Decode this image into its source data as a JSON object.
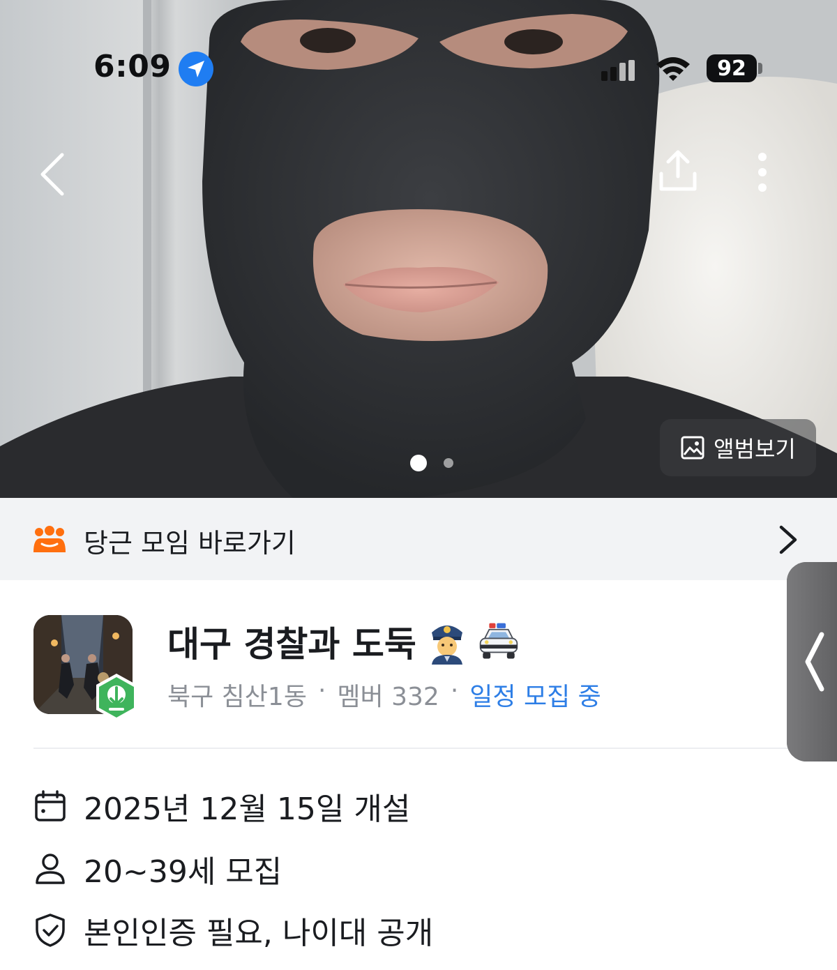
{
  "status_bar": {
    "time": "6:09",
    "battery": "92",
    "icons": [
      "location-arrow-icon",
      "cellular-signal-icon",
      "wifi-icon",
      "battery-icon"
    ]
  },
  "header": {
    "back_icon": "chevron-left-icon",
    "share_icon": "share-icon",
    "more_icon": "more-vertical-icon"
  },
  "gallery": {
    "album_label": "앨범보기",
    "album_icon": "image-icon",
    "pages": 2,
    "current_page": 1
  },
  "shortcut": {
    "label": "당근 모임 바로가기",
    "icon": "group-people-icon",
    "chevron_icon": "chevron-right-icon",
    "icon_color": "#ff6f0f"
  },
  "group": {
    "title": "대구 경찰과 도둑",
    "title_emojis": [
      "police-officer-emoji",
      "police-car-emoji"
    ],
    "location": "북구 침산1동",
    "members": "멤버 332",
    "status": "일정 모집 중",
    "status_color": "#2d7ee6",
    "badge_color": "#3fb45c"
  },
  "details": {
    "founded": "2025년 12월 15일 개설",
    "age": "20~39세 모집",
    "requirements": "본인인증 필요, 나이대 공개"
  }
}
